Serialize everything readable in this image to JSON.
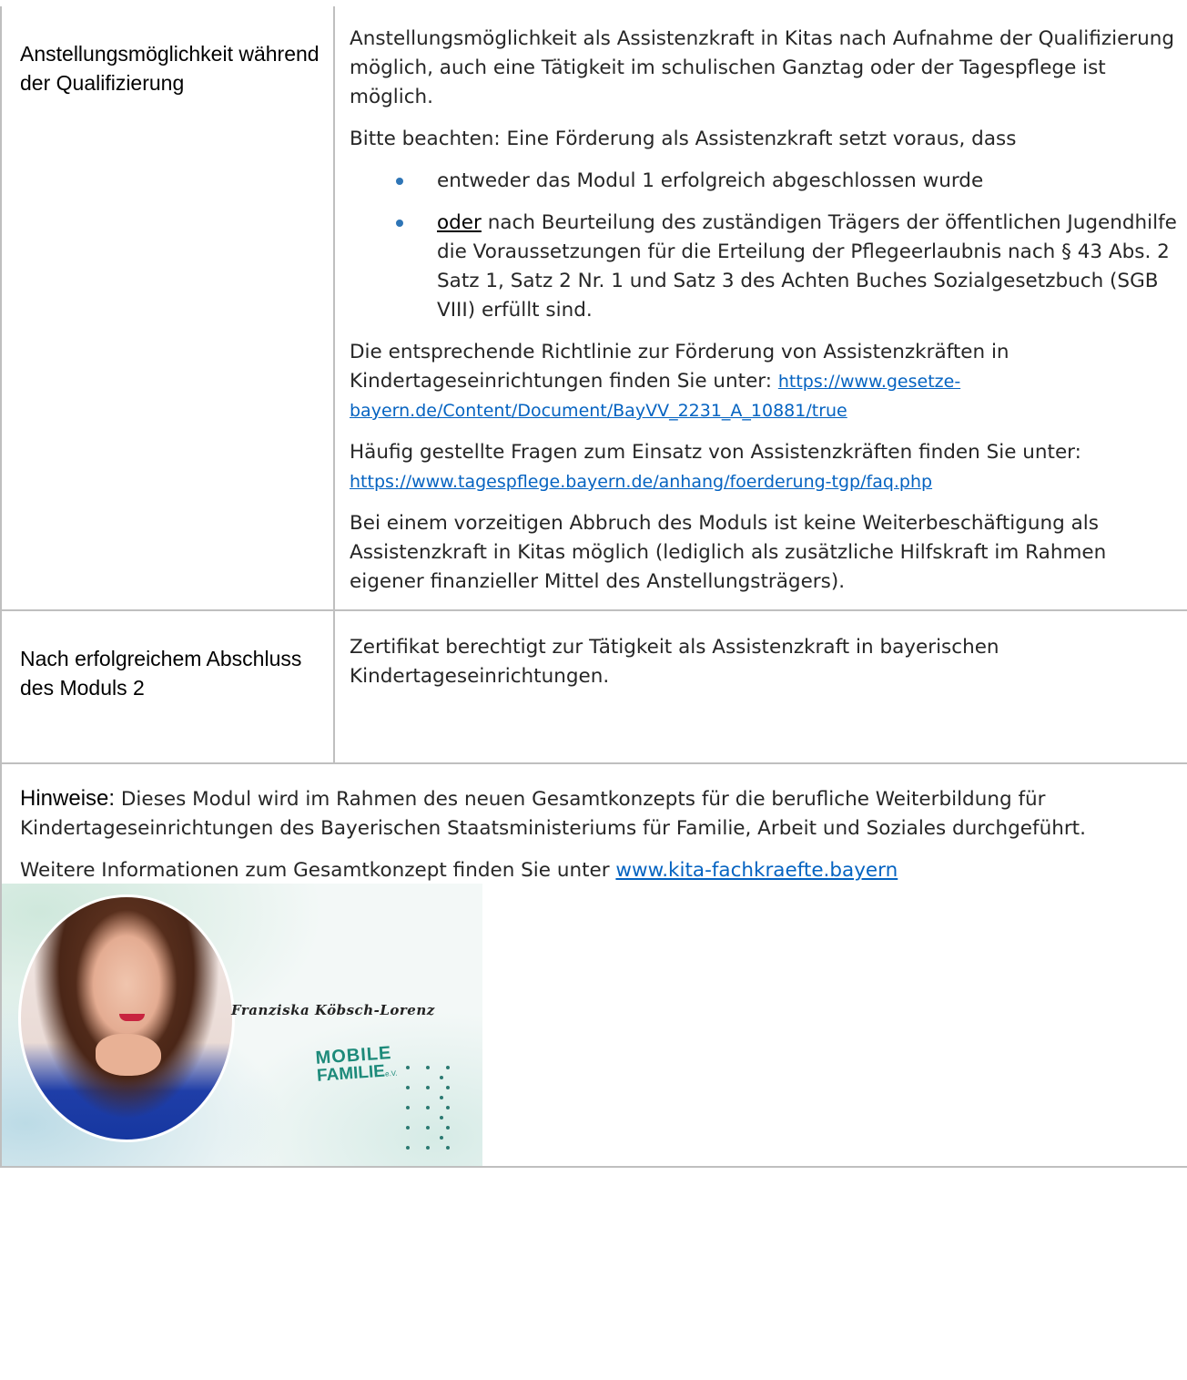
{
  "row1": {
    "label": "Anstellungsmöglichkeit während der Qualifizierung",
    "p1": "Anstellungsmöglichkeit als Assistenzkraft in Kitas nach Aufnahme der Qualifizierung möglich, auch eine Tätigkeit im schulischen Ganztag oder der Tagespflege ist möglich.",
    "p2": "Bitte beachten: Eine Förderung als Assistenzkraft setzt voraus, dass",
    "bullet1": "entweder das Modul 1 erfolgreich abgeschlossen wurde",
    "bullet2_emph": "oder",
    "bullet2_rest": " nach Beurteilung des zuständigen Trägers der öffentlichen Jugendhilfe die Voraussetzungen für die Erteilung der Pflegeerlaubnis nach § 43 Abs. 2 Satz 1, Satz 2 Nr. 1 und Satz 3 des Achten Buches Sozialgesetzbuch (SGB VIII) erfüllt sind.",
    "p3_text": "Die entsprechende Richtlinie zur Förderung von Assistenzkräften in Kindertageseinrichtungen finden Sie unter: ",
    "p3_link": "https://www.gesetze-bayern.de/Content/Document/BayVV_2231_A_10881/true",
    "p4_text": "Häufig gestellte Fragen zum Einsatz von Assistenzkräften finden Sie unter:",
    "p4_link": "https://www.tagespflege.bayern.de/anhang/foerderung-tgp/faq.php",
    "p5": "Bei einem vorzeitigen Abbruch des Moduls ist keine Weiterbeschäftigung als Assistenzkraft in Kitas möglich (lediglich als zusätzliche Hilfskraft im Rahmen eigener finanzieller Mittel des Anstellungsträgers)."
  },
  "row2": {
    "label": "Nach erfolgreichem Abschluss des Moduls 2",
    "text": "Zertifikat berechtigt zur Tätigkeit als Assistenzkraft in bayerischen Kindertageseinrichtungen."
  },
  "hinweise": {
    "title": "Hinweise:",
    "text": " Dieses Modul wird im Rahmen des neuen Gesamtkonzepts für die berufliche Weiterbildung für Kindertageseinrichtungen des Bayerischen Staatsministeriums für Familie, Arbeit und Soziales durchgeführt.",
    "more_text": "Weitere Informationen zum Gesamtkonzept finden Sie unter ",
    "more_link": "www.kita-fachkraefte.bayern"
  },
  "banner": {
    "signature": "Franziska Köbsch-Lorenz",
    "logo_line1": "MOBILE",
    "logo_line2": "FAMILIE",
    "logo_suffix": "e.V."
  },
  "colors": {
    "link": "#0563c1",
    "bullet": "#2e75b6",
    "border": "#bfbfbf"
  }
}
